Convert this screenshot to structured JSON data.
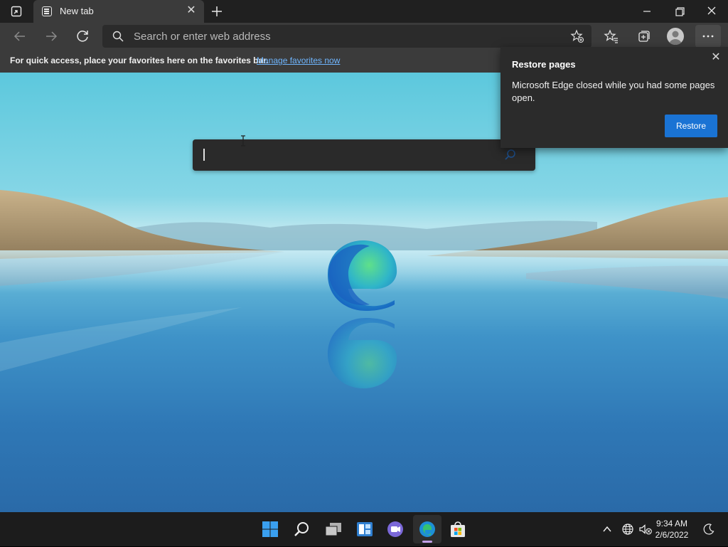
{
  "browser": {
    "tab": {
      "title": "New tab"
    },
    "address_bar": {
      "placeholder": "Search or enter web address"
    },
    "favorites_bar": {
      "message": "For quick access, place your favorites here on the favorites bar.",
      "link": "Manage favorites now"
    }
  },
  "popup": {
    "title": "Restore pages",
    "body": "Microsoft Edge closed while you had some pages open.",
    "button": "Restore"
  },
  "taskbar": {
    "time": "9:34 AM",
    "date": "2/6/2022"
  },
  "colors": {
    "accent": "#1a73d4",
    "link": "#6fb6ff",
    "chrome": "#3b3b3b",
    "titlebar": "#202020",
    "taskbar": "#1c1c1c"
  }
}
